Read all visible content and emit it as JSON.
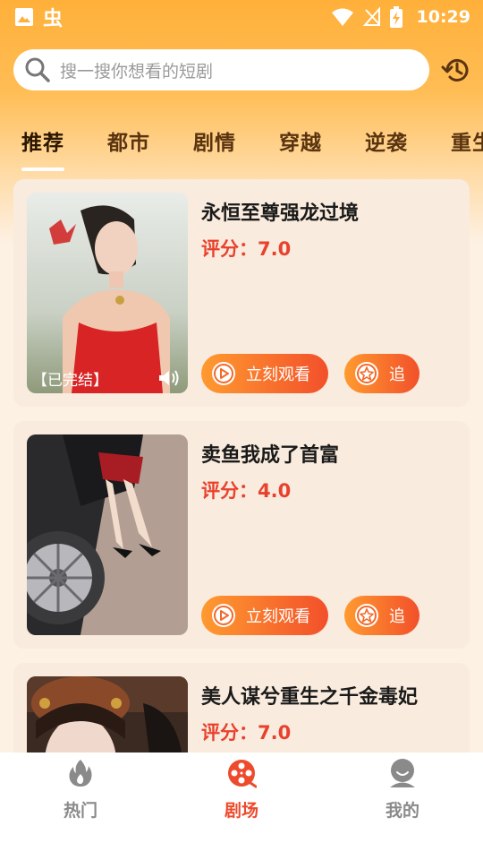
{
  "status_bar": {
    "time": "10:29",
    "app_glyph": "虫"
  },
  "search": {
    "placeholder": "搜一搜你想看的短剧"
  },
  "tabs": [
    {
      "label": "推荐",
      "active": true
    },
    {
      "label": "都市"
    },
    {
      "label": "剧情"
    },
    {
      "label": "穿越"
    },
    {
      "label": "逆袭"
    },
    {
      "label": "重生"
    }
  ],
  "dramas": [
    {
      "title": "永恒至尊强龙过境",
      "rating": "评分：7.0",
      "status_label": "【已完结】",
      "watch_label": "立刻观看",
      "follow_label": "追"
    },
    {
      "title": "卖鱼我成了首富",
      "rating": "评分：4.0",
      "watch_label": "立刻观看",
      "follow_label": "追"
    },
    {
      "title": "美人谋兮重生之千金毒妃",
      "rating": "评分：7.0"
    }
  ],
  "bottom_nav": [
    {
      "label": "热门",
      "icon": "flame-icon"
    },
    {
      "label": "剧场",
      "icon": "film-reel-icon",
      "active": true
    },
    {
      "label": "我的",
      "icon": "user-icon"
    }
  ],
  "colors": {
    "accent": "#ee4a2c",
    "header": "#ffb03a",
    "card_bg": "#f9ebdd",
    "rating": "#e8412d"
  }
}
